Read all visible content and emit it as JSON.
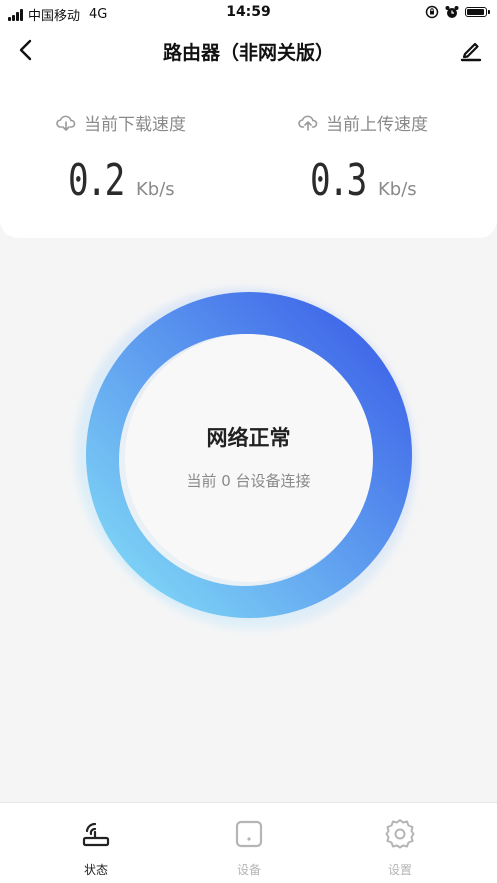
{
  "status_bar": {
    "carrier": "中国移动",
    "network": "4G",
    "time": "14:59"
  },
  "header": {
    "title": "路由器（非网关版）"
  },
  "speeds": {
    "download": {
      "label": "当前下载速度",
      "value": "0.2",
      "unit": "Kb/s",
      "icon": "cloud-download-icon"
    },
    "upload": {
      "label": "当前上传速度",
      "value": "0.3",
      "unit": "Kb/s",
      "icon": "cloud-upload-icon"
    }
  },
  "network": {
    "status": "网络正常",
    "connected": "当前 0 台设备连接"
  },
  "tabs": [
    {
      "label": "状态",
      "icon": "router-icon",
      "active": true
    },
    {
      "label": "设备",
      "icon": "device-icon",
      "active": false
    },
    {
      "label": "设置",
      "icon": "gear-icon",
      "active": false
    }
  ],
  "colors": {
    "ring_start": "#7fd6f6",
    "ring_end": "#3d63e8",
    "tab_active": "#222222",
    "tab_inactive": "#b5b5b5"
  }
}
